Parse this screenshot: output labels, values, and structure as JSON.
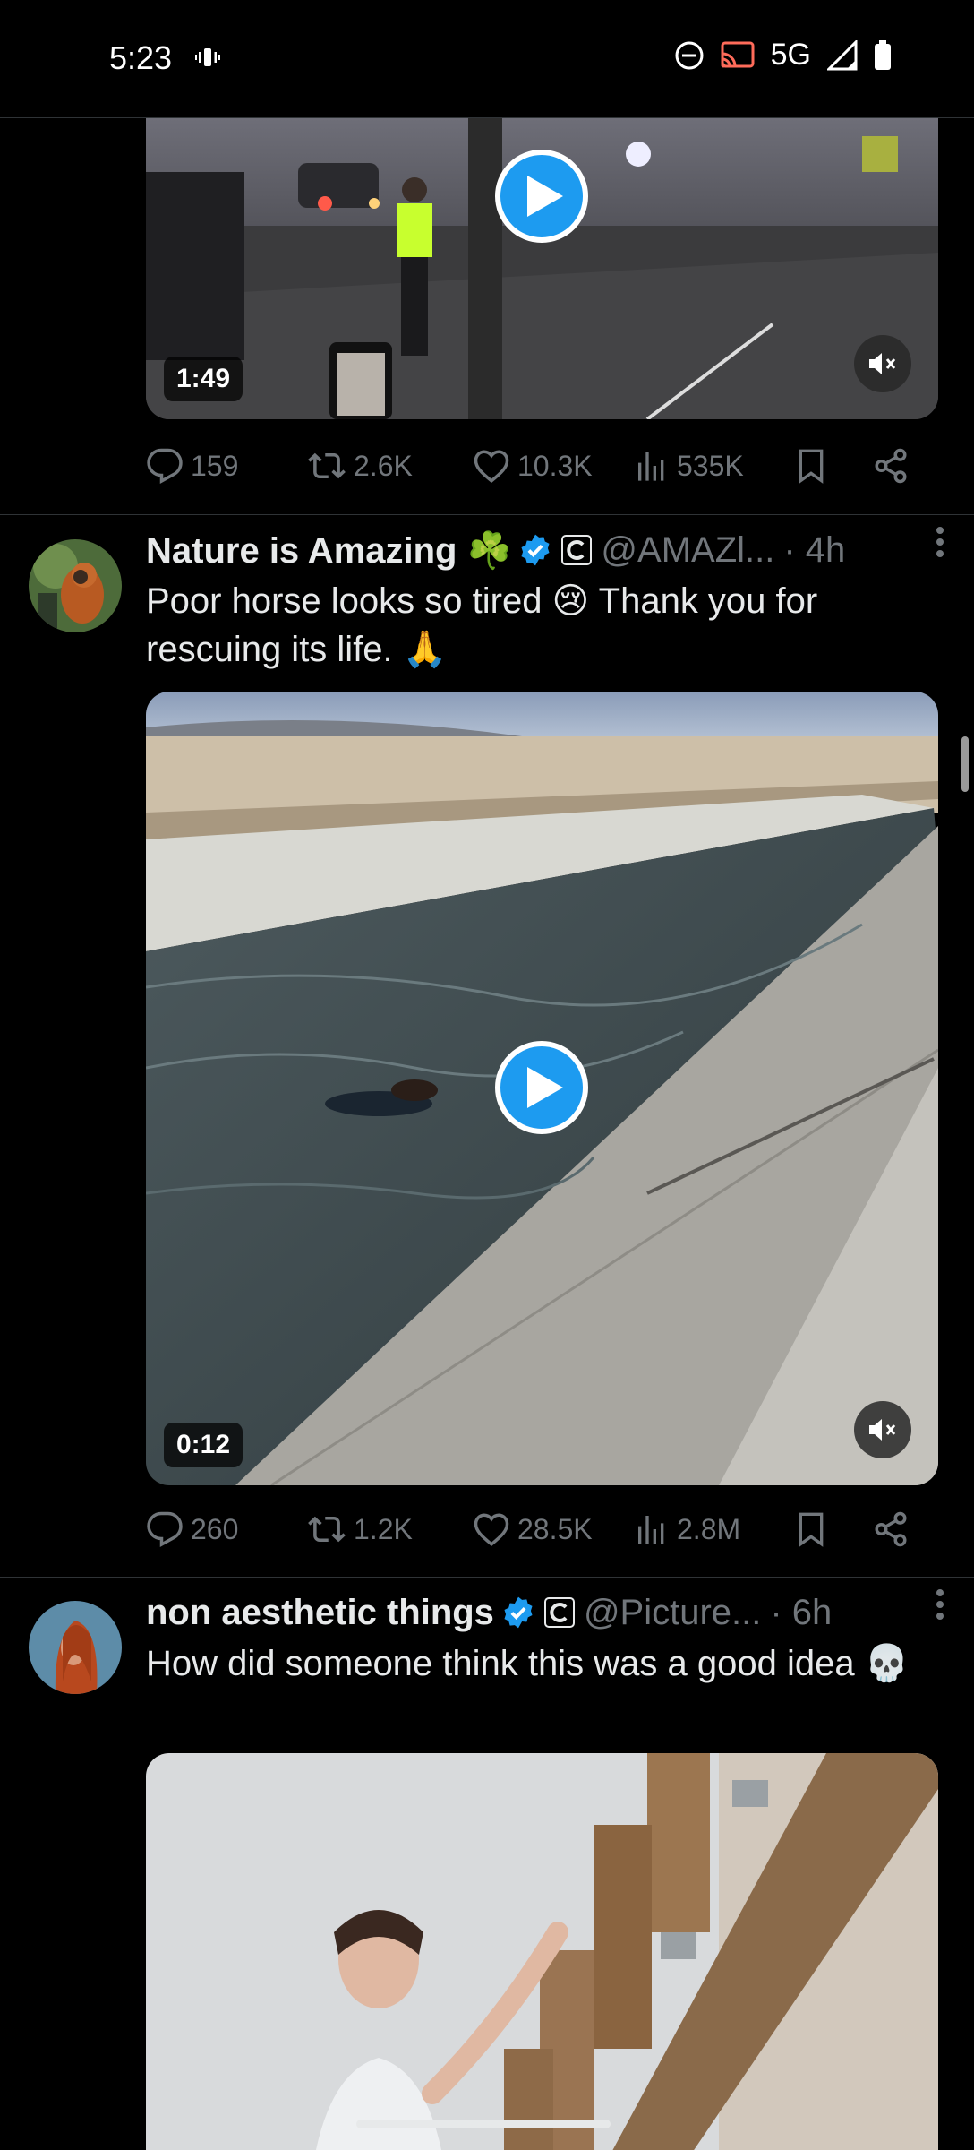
{
  "status_bar": {
    "time": "5:23",
    "network": "5G",
    "icons": [
      "vibrate-icon",
      "dnd-icon",
      "cast-icon",
      "signal-icon",
      "battery-icon"
    ]
  },
  "colors": {
    "accent": "#1d9bf0",
    "background": "#000000",
    "muted_text": "#71767b",
    "divider": "#2f3336"
  },
  "tweets": [
    {
      "media": {
        "duration": "1:49",
        "type": "video",
        "icon": "play-icon"
      },
      "stats": {
        "replies": "159",
        "retweets": "2.6K",
        "likes": "10.3K",
        "views": "535K"
      }
    },
    {
      "name": "Nature is Amazing ☘️",
      "handle": "@AMAZl...",
      "time": "· 4h",
      "text": "Poor horse looks so tired 😢 Thank you for rescuing its life. 🙏",
      "media": {
        "duration": "0:12",
        "type": "video",
        "icon": "play-icon"
      },
      "stats": {
        "replies": "260",
        "retweets": "1.2K",
        "likes": "28.5K",
        "views": "2.8M"
      }
    },
    {
      "name": "non aesthetic things",
      "handle": "@Picture...",
      "time": "· 6h",
      "text": "How did someone think this was a good idea 💀",
      "media": {
        "type": "image"
      }
    }
  ]
}
